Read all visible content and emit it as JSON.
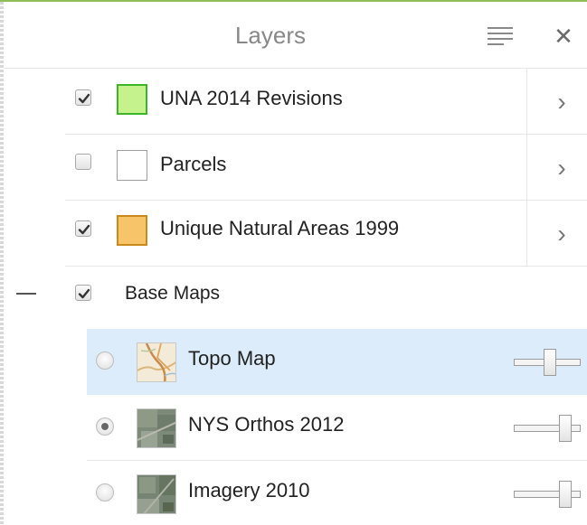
{
  "header": {
    "title": "Layers",
    "menu_icon": "hamburger-menu-icon",
    "close_symbol": "✕"
  },
  "layers": [
    {
      "label": "UNA 2014 Revisions",
      "checked": true,
      "swatch_fill": "#c6f28e",
      "swatch_border": "#3bb52a",
      "chevron": "›"
    },
    {
      "label": "Parcels",
      "checked": false,
      "swatch_fill": "#ffffff",
      "swatch_border": "#9e9e9e",
      "chevron": "›"
    },
    {
      "label": "Unique Natural Areas 1999",
      "checked": true,
      "swatch_fill": "#f7c46a",
      "swatch_border": "#c98a1b",
      "chevron": "›"
    }
  ],
  "base_maps": {
    "label": "Base Maps",
    "checked": true,
    "collapse_icon": "minus-collapse-icon",
    "items": [
      {
        "label": "Topo Map",
        "selected": false,
        "highlighted": true,
        "opacity": 0.55,
        "thumb_icon": "topo-map-thumbnail"
      },
      {
        "label": "NYS Orthos 2012",
        "selected": true,
        "highlighted": false,
        "opacity": 0.82,
        "thumb_icon": "aerial-imagery-thumbnail"
      },
      {
        "label": "Imagery 2010",
        "selected": false,
        "highlighted": false,
        "opacity": 0.82,
        "thumb_icon": "aerial-imagery-thumbnail"
      }
    ]
  },
  "colors": {
    "accent": "#8fbe5a",
    "selected_row": "#dcecfa",
    "divider": "#e6e6e6"
  }
}
